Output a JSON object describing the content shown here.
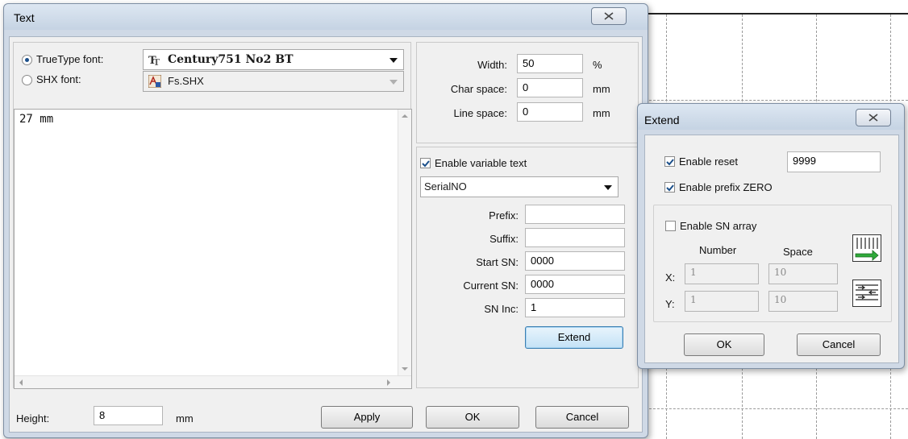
{
  "text_dialog": {
    "title": "Text",
    "truetype_label": "TrueType font:",
    "truetype_value": "Century751 No2 BT",
    "shx_label": "SHX font:",
    "shx_value": "Fs.SHX",
    "text_content": "27 mm",
    "width_label": "Width:",
    "width_value": "50",
    "width_unit": "%",
    "char_space_label": "Char space:",
    "char_space_value": "0",
    "char_space_unit": "mm",
    "line_space_label": "Line space:",
    "line_space_value": "0",
    "line_space_unit": "mm",
    "enable_variable_label": "Enable variable text",
    "variable_type": "SerialNO",
    "prefix_label": "Prefix:",
    "prefix_value": "",
    "suffix_label": "Suffix:",
    "suffix_value": "",
    "start_sn_label": "Start SN:",
    "start_sn_value": "0000",
    "current_sn_label": "Current SN:",
    "current_sn_value": "0000",
    "sn_inc_label": "SN Inc:",
    "sn_inc_value": "1",
    "extend_label": "Extend",
    "height_label": "Height:",
    "height_value": "8",
    "height_unit": "mm",
    "apply_label": "Apply",
    "ok_label": "OK",
    "cancel_label": "Cancel"
  },
  "extend_dialog": {
    "title": "Extend",
    "enable_reset_label": "Enable reset",
    "reset_value": "9999",
    "enable_prefix_zero_label": "Enable prefix ZERO",
    "enable_sn_array_label": "Enable SN array",
    "number_header": "Number",
    "space_header": "Space",
    "x_label": "X:",
    "x_number": "1",
    "x_space": "10",
    "y_label": "Y:",
    "y_number": "1",
    "y_space": "10",
    "ok_label": "OK",
    "cancel_label": "Cancel"
  }
}
